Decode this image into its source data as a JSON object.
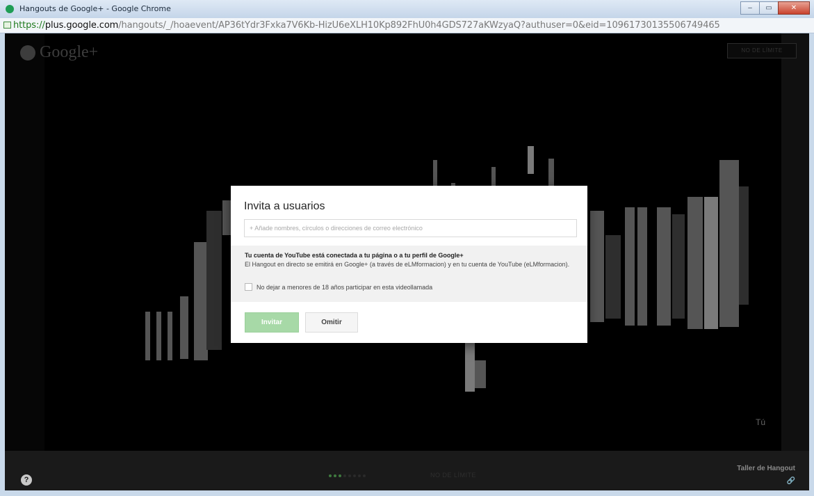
{
  "window": {
    "title": "Hangouts de Google+ - Google Chrome",
    "minimize": "–",
    "maximize": "▭",
    "close": "✕"
  },
  "address_bar": {
    "scheme": "https://",
    "host": "plus.google.com",
    "path": "/hangouts/_/hoaevent/AP36tYdr3Fxka7V6Kb-HizU6eXLH10Kp892FhU0h4GDS727aKWzyaQ?authuser=0&eid=10961730135506749465"
  },
  "hangout": {
    "logo": "Google+",
    "no_limit_label": "NO DE LÍMITE",
    "self_label": "Tú",
    "help": "?",
    "bottom_no_limit": "NO DE LÍMITE",
    "taller_label": "Taller de Hangout",
    "link_icon": "🔗"
  },
  "dialog": {
    "title": "Invita a usuarios",
    "input_placeholder": "+ Añade nombres, círculos o direcciones de correo electrónico",
    "info_bold": "Tu cuenta de YouTube está conectada a tu página o a tu perfil de Google+",
    "info_text": "El Hangout en directo se emitirá en Google+ (a través de eLMformacion) y en tu cuenta de YouTube (eLMformacion).",
    "checkbox_label": "No dejar a menores de 18 años participar en esta videollamada",
    "invite_button": "Invitar",
    "skip_button": "Omitir"
  }
}
